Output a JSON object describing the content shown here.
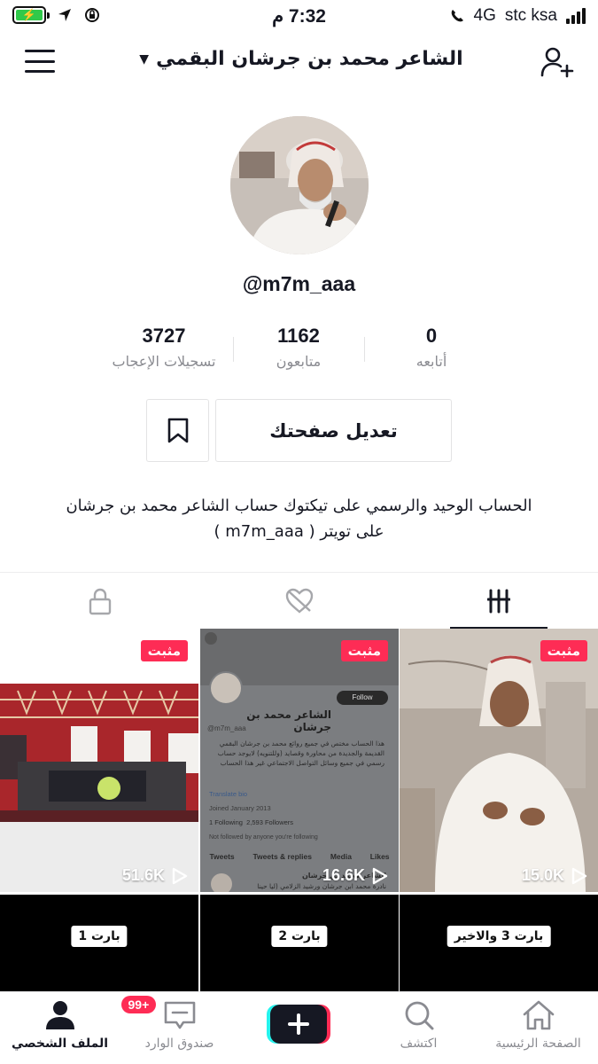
{
  "status_bar": {
    "time": "7:32 م",
    "network": "4G",
    "carrier": "stc ksa",
    "battery_color": "#30c94a"
  },
  "header": {
    "title": "الشاعر محمد بن جرشان البقمي",
    "chevron_icon": "chevron-down-icon",
    "menu_icon": "hamburger-menu-icon",
    "add_user_icon": "add-user-icon"
  },
  "profile": {
    "username": "@m7m_aaa",
    "stats": [
      {
        "value": "0",
        "label": "أتابعه"
      },
      {
        "value": "1162",
        "label": "متابعون"
      },
      {
        "value": "3727",
        "label": "تسجيلات الإعجاب"
      }
    ],
    "edit_button": "تعديل صفحتك",
    "bio_line1": "الحساب الوحيد والرسمي على تيكتوك حساب الشاعر محمد بن جرشان",
    "bio_line2": "على تويتر ( m7m_aaa )"
  },
  "tabs": [
    {
      "icon": "grid-icon",
      "active": true
    },
    {
      "icon": "liked-heart-icon",
      "active": false
    },
    {
      "icon": "lock-icon",
      "active": false
    }
  ],
  "videos": [
    {
      "pinned": "مثبت",
      "views": "15.0K"
    },
    {
      "pinned": "مثبت",
      "views": "16.6K"
    },
    {
      "pinned": "مثبت",
      "views": "51.6K"
    }
  ],
  "twitter_card": {
    "name": "الشاعر محمد بن جرشان",
    "handle": "@m7m_aaa",
    "follow": "Follow",
    "bio": "هذا الحساب مختص في جميع روائع محمد بن جرشان البقمي القديمة والجديدة من محاورة وقصايد (وللتنويه) لايوجد حساب رسمي في جميع وسائل التواصل الاجتماعي غير هذا الحساب",
    "translate": "Translate bio",
    "joined": "Joined January 2013",
    "following": "1 Following",
    "followers": "2,593 Followers",
    "not_followed": "Not followed by anyone you're following",
    "tabs": [
      "Tweets",
      "Tweets & replies",
      "Media",
      "Likes"
    ],
    "tweet_name": "الشاعر محمد بن جرشان",
    "tweet_text": "نادرة محمد ابن جرشان ورشيد الزلامي (ليا حينا"
  },
  "parts": [
    {
      "label": "بارت 3 والاخير"
    },
    {
      "label": "بارت 2"
    },
    {
      "label": "بارت 1"
    }
  ],
  "bottom_nav": [
    {
      "label": "الصفحة الرئيسية",
      "icon": "home-icon"
    },
    {
      "label": "اكتشف",
      "icon": "search-icon"
    },
    {
      "label": "",
      "icon": "plus-icon"
    },
    {
      "label": "صندوق الوارد",
      "icon": "inbox-icon",
      "badge": "99+"
    },
    {
      "label": "الملف الشخصي",
      "icon": "profile-icon",
      "active": true
    }
  ],
  "colors": {
    "accent": "#fe2c55",
    "text": "#161823",
    "muted": "#8a8b91"
  }
}
